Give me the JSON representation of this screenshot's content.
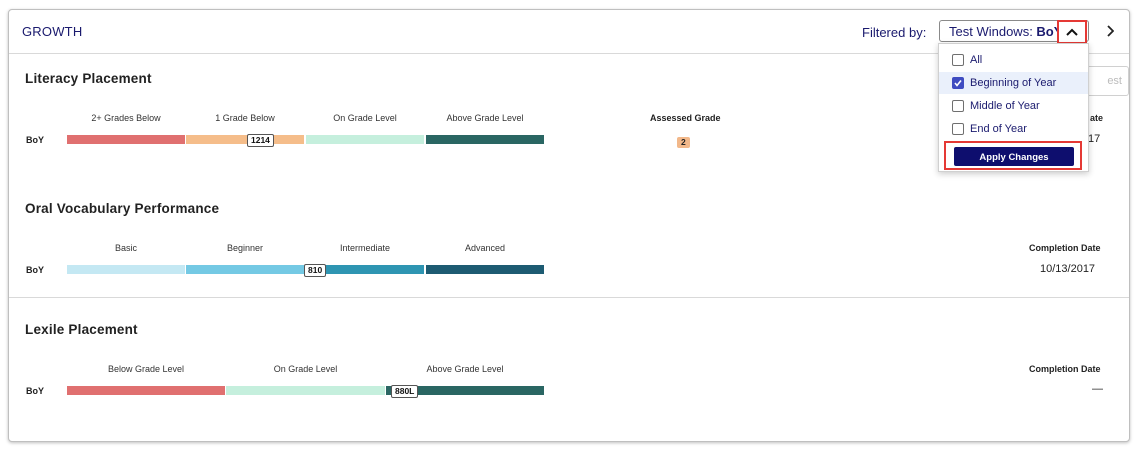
{
  "header": {
    "title": "GROWTH",
    "filter_label": "Filtered by:",
    "filter_prefix": "Test Windows: ",
    "filter_value": "BoY"
  },
  "dropdown": {
    "options": [
      {
        "label": "All",
        "checked": false
      },
      {
        "label": "Beginning of Year",
        "checked": true
      },
      {
        "label": "Middle of Year",
        "checked": false
      },
      {
        "label": "End of Year",
        "checked": false
      }
    ],
    "apply_label": "Apply Changes"
  },
  "partial_button_label": "est",
  "literacy": {
    "title": "Literacy Placement",
    "row_label": "BoY",
    "levels": [
      "2+ Grades Below",
      "1 Grade Below",
      "On Grade Level",
      "Above Grade Level"
    ],
    "score": "1214",
    "assessed_grade_label": "Assessed Grade",
    "assessed_grade": "2",
    "date_label_partial": "ate",
    "date_value_partial": "17"
  },
  "vocabulary": {
    "title": "Oral Vocabulary Performance",
    "row_label": "BoY",
    "levels": [
      "Basic",
      "Beginner",
      "Intermediate",
      "Advanced"
    ],
    "score": "810",
    "completion_label": "Completion Date",
    "completion_date": "10/13/2017"
  },
  "lexile": {
    "title": "Lexile Placement",
    "row_label": "BoY",
    "levels": [
      "Below Grade Level",
      "On Grade Level",
      "Above Grade Level"
    ],
    "score": "880L",
    "completion_label": "Completion Date",
    "completion_date": "—"
  },
  "colors": {
    "literacy": [
      "#e07070",
      "#f5bd8a",
      "#c5efdd",
      "#2a6663"
    ],
    "vocabulary": [
      "#c4e8f3",
      "#74c9e4",
      "#2e95b2",
      "#1d5b72"
    ],
    "lexile": [
      "#e07070",
      "#c5efdd",
      "#2a6663"
    ],
    "accent": "#1a1a6e",
    "highlight": "#e53935"
  },
  "icons": {
    "chevron_up": "chevron-up-icon",
    "chevron_right": "chevron-right-icon",
    "check": "check-icon"
  }
}
